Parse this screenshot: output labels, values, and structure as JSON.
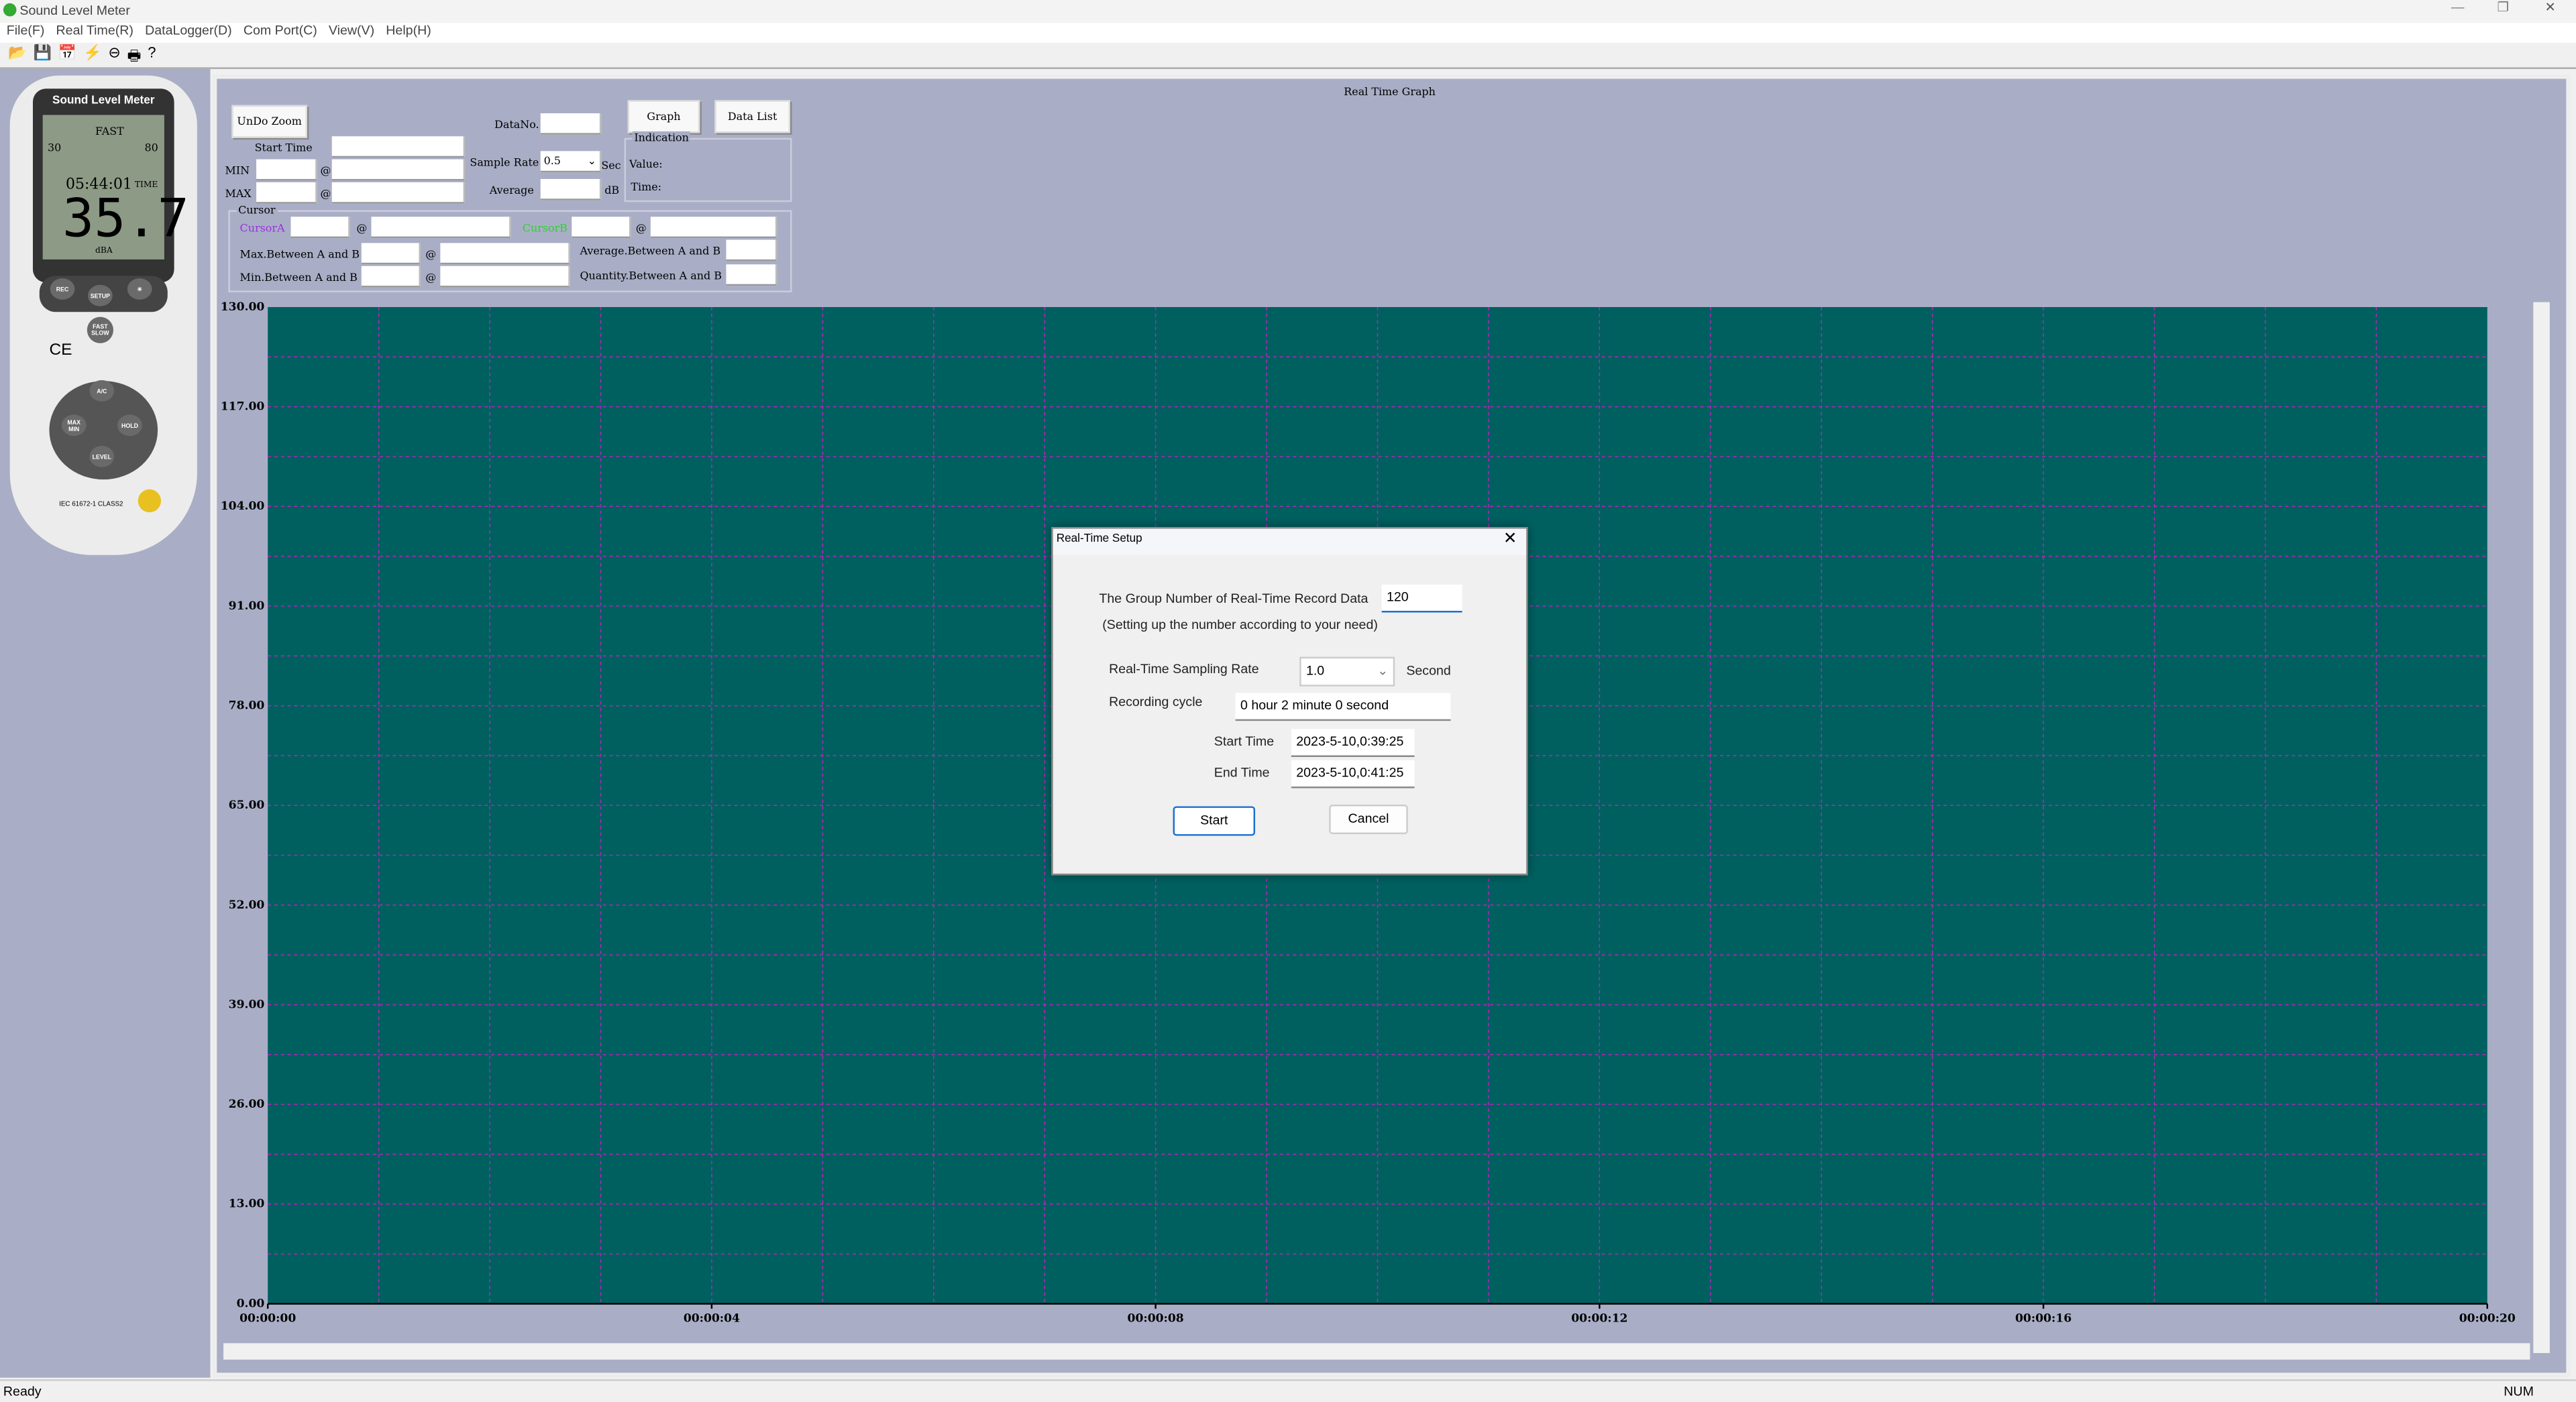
{
  "window": {
    "title": "Sound Level Meter"
  },
  "menu": [
    "File(F)",
    "Real Time(R)",
    "DataLogger(D)",
    "Com Port(C)",
    "View(V)",
    "Help(H)"
  ],
  "toolbar": [
    "open-icon",
    "save-icon",
    "calendar-icon",
    "lightning-icon",
    "stop-icon",
    "print-icon",
    "help-icon"
  ],
  "meter": {
    "brand": "Sound Level Meter",
    "mode": "FAST",
    "range_low": "30",
    "range_high": "80",
    "time": "05:44:01",
    "time_label": "TIME",
    "reading": "35.7",
    "unit": "dBA",
    "buttons": [
      "REC",
      "SETUP",
      "A/C",
      "MAX MIN",
      "HOLD",
      "LEVEL",
      "FAST SLOW"
    ],
    "standard": "IEC 61672-1 CLASS2"
  },
  "panel": {
    "undo_zoom": "UnDo Zoom",
    "datano_label": "DataNo.",
    "graph_btn": "Graph",
    "datalist_btn": "Data List",
    "start_time_label": "Start Time",
    "min_label": "MIN",
    "max_label": "MAX",
    "at": "@",
    "sample_rate_label": "Sample Rate",
    "sample_rate_value": "0.5",
    "sec": "Sec",
    "average_label": "Average",
    "db": "dB",
    "indication": "Indication",
    "value_label": "Value:",
    "time_label": "Time:",
    "cursor": "Cursor",
    "cursor_a": "CursorA",
    "cursor_b": "CursorB",
    "max_ab": "Max.Between A and B",
    "min_ab": "Min.Between A and B",
    "avg_ab": "Average.Between A and B",
    "qty_ab": "Quantity.Between A and B",
    "cursor_a_color": "#9a30e0",
    "cursor_b_color": "#30d030"
  },
  "graph": {
    "title": "Real Time Graph",
    "bg": "#006060",
    "grid_color": "#c020c0",
    "y_ticks": [
      "0.00",
      "13.00",
      "26.00",
      "39.00",
      "52.00",
      "65.00",
      "78.00",
      "91.00",
      "104.00",
      "117.00",
      "130.00"
    ],
    "x_ticks": [
      "00:00:00",
      "00:00:04",
      "00:00:08",
      "00:00:12",
      "00:00:16",
      "00:00:20"
    ]
  },
  "dialog": {
    "title": "Real-Time Setup",
    "group_label": "The Group Number of Real-Time Record Data",
    "group_value": "120",
    "hint": "(Setting up the number according to your need)",
    "rate_label": "Real-Time Sampling Rate",
    "rate_value": "1.0",
    "second": "Second",
    "cycle_label": "Recording cycle",
    "cycle_value": "0 hour 2 minute 0 second",
    "start_label": "Start Time",
    "start_value": "2023-5-10,0:39:25",
    "end_label": "End Time",
    "end_value": "2023-5-10,0:41:25",
    "start_btn": "Start",
    "cancel_btn": "Cancel"
  },
  "status": {
    "left": "Ready",
    "right": "NUM"
  }
}
